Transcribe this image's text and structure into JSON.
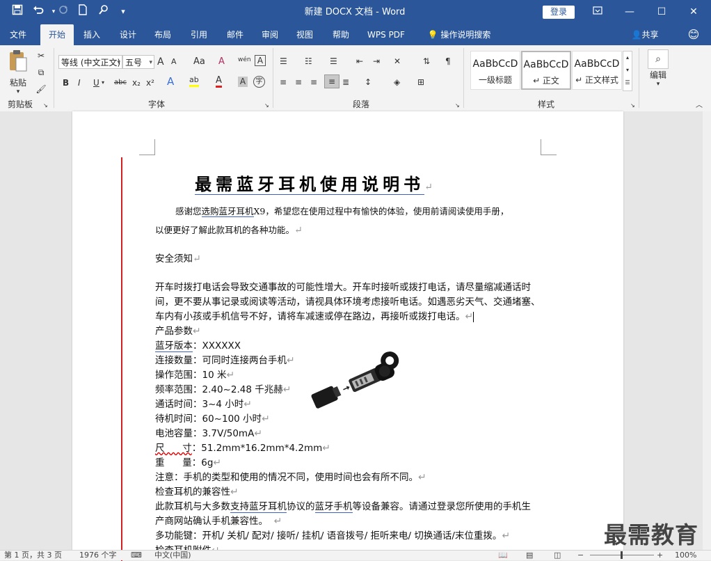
{
  "window": {
    "title": "新建 DOCX 文档 - Word",
    "login_label": "登录",
    "ribbon_display_icon": "ribbon-display-icon",
    "minimize_icon": "minimize-icon",
    "maximize_icon": "maximize-icon",
    "close_icon": "close-icon"
  },
  "quick_access": {
    "save_icon": "save-icon",
    "undo_icon": "undo-icon",
    "redo_icon": "redo-icon",
    "new_icon": "new-document-icon",
    "touch_icon": "touch-mode-icon",
    "customize_icon": "customize-qat-icon"
  },
  "tabs": [
    {
      "label": "文件"
    },
    {
      "label": "开始",
      "active": true
    },
    {
      "label": "插入"
    },
    {
      "label": "设计"
    },
    {
      "label": "布局"
    },
    {
      "label": "引用"
    },
    {
      "label": "邮件"
    },
    {
      "label": "审阅"
    },
    {
      "label": "视图"
    },
    {
      "label": "帮助"
    },
    {
      "label": "WPS PDF"
    },
    {
      "label": "操作说明搜索"
    }
  ],
  "share_label": "共享",
  "ribbon": {
    "clipboard": {
      "paste_label": "粘贴",
      "group_label": "剪贴板"
    },
    "font": {
      "font_name": "等线 (中文正文)",
      "font_size": "五号",
      "bold": "B",
      "italic": "I",
      "underline": "U",
      "strikethrough": "abc",
      "subscript": "x₂",
      "superscript": "x²",
      "grow": "A",
      "shrink": "A",
      "change_case": "Aa",
      "clear": "A",
      "phonetic": "wén",
      "border": "A",
      "effects": "A",
      "highlight": "ab",
      "color": "A",
      "shading": "A",
      "enclose": "字",
      "group_label": "字体"
    },
    "paragraph": {
      "group_label": "段落"
    },
    "styles": {
      "items": [
        {
          "sample": "AaBbCcD",
          "name": "一级标题"
        },
        {
          "sample": "AaBbCcD",
          "name": "↵ 正文"
        },
        {
          "sample": "AaBbCcD",
          "name": "↵ 正文样式"
        }
      ],
      "group_label": "样式"
    },
    "editing": {
      "label": "编辑"
    }
  },
  "document": {
    "title": "最需蓝牙耳机使用说明书",
    "intro_line1_pre": "感谢您",
    "intro_line1_link": "选购蓝牙耳机",
    "intro_line1_post": "X9，希望您在使用过程中有愉快的体验，使用前请阅读使用手册，",
    "intro_line2": "以便更好了解此款耳机的各种功能。",
    "safety_heading": "安全须知",
    "safety_lines": [
      "开车时拨打电话会导致交通事故的可能性增大。开车时接听或拨打电话，请尽量缩减通话时",
      "间，更不要从事记录或阅读等活动，请视具体环境考虑接听电话。如遇恶劣天气、交通堵塞、",
      "车内有小孩或手机信号不好，请将车减速或停在路边，再接听或拨打电话。"
    ],
    "params_heading": "产品参数",
    "params": [
      {
        "label": "蓝牙版本",
        "value": "XXXXXX",
        "underline": true
      },
      {
        "label": "连接数量",
        "value": "可同时连接两台手机"
      },
      {
        "label": "操作范围",
        "value": "10 米"
      },
      {
        "label": "频率范围",
        "value": "2.40~2.48 千兆赫"
      },
      {
        "label": "通话时间",
        "value": "3~4 小时"
      },
      {
        "label": "待机时间",
        "value": "60~100 小时"
      },
      {
        "label": "电池容量",
        "value": "3.7V/50mA"
      },
      {
        "label": "尺      寸",
        "value": "51.2mm*16.2mm*4.2mm"
      },
      {
        "label": "重      量",
        "value": "6g"
      }
    ],
    "note": "注意：手机的类型和使用的情况不同，使用时间也会有所不同。",
    "compat_heading": "检查耳机的兼容性",
    "compat_line1_a": "此款耳机与大多数",
    "compat_line1_b": "支持蓝牙耳机",
    "compat_line1_c": "协议的",
    "compat_line1_d": "蓝牙手机",
    "compat_line1_e": "等设备兼容。请通过登录您所使用的手机生",
    "compat_line2": "产商网站确认手机兼容性。",
    "multi_function": "多功能键：开机/ 关机/ 配对/ 接听/ 挂机/ 语音拨号/ 拒听来电/ 切换通话/末位重拨。",
    "accessories_heading": "检查耳机附件"
  },
  "watermark": "最需教育",
  "status": {
    "page": "第 1 页，共 3 页",
    "words": "1976 个字",
    "language": "中文(中国)",
    "zoom": "100%"
  }
}
